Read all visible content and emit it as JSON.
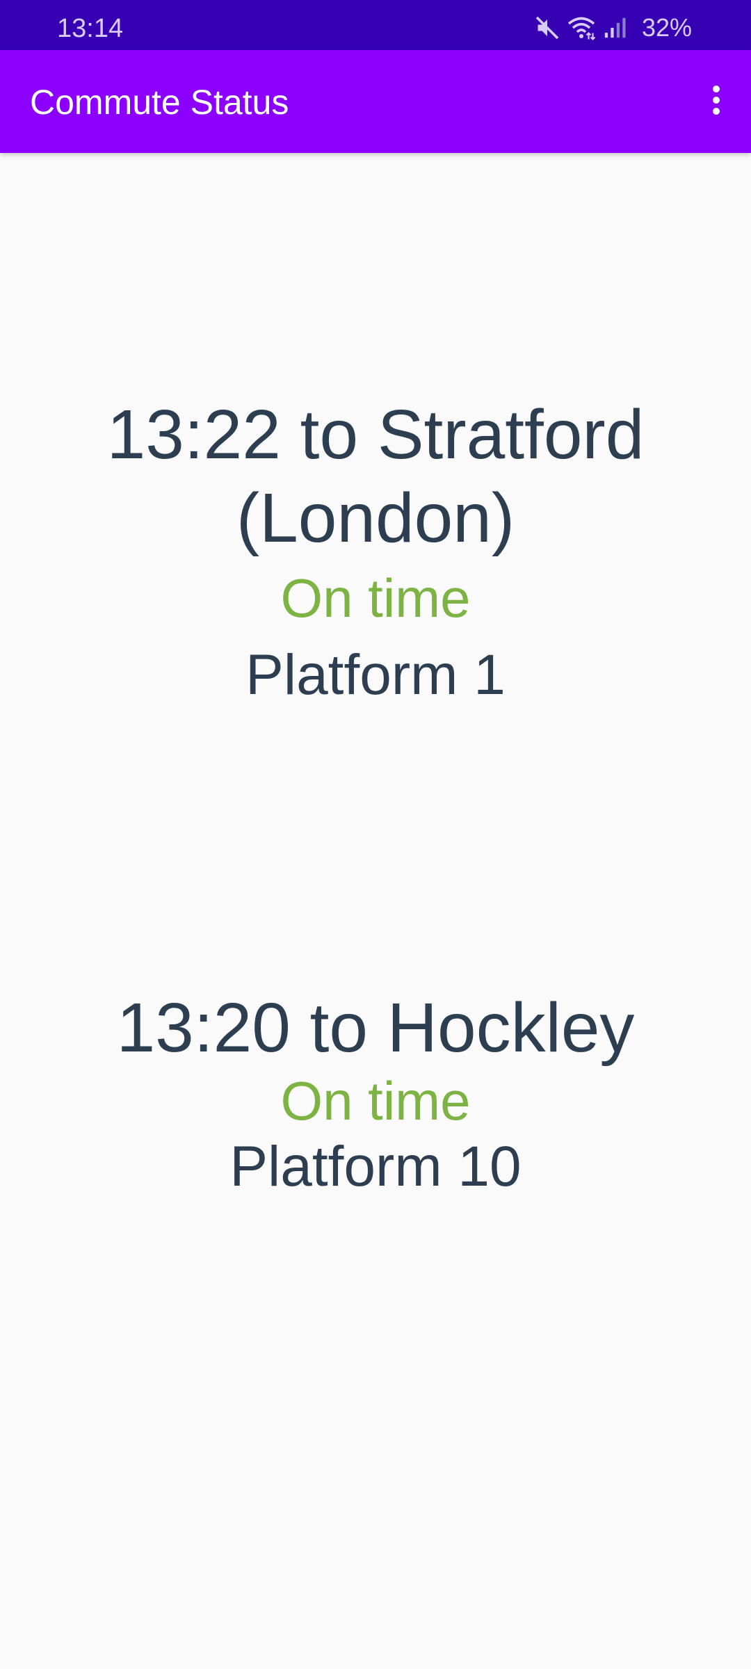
{
  "status_bar": {
    "time": "13:14",
    "battery": "32%",
    "icons": [
      "mute-icon",
      "wifi-icon",
      "signal-icon"
    ]
  },
  "app_bar": {
    "title": "Commute Status",
    "menu_icon": "more-vert-icon"
  },
  "colors": {
    "status_bar": "#3700b3",
    "app_bar": "#8c00ff",
    "text": "#2c3e50",
    "on_time": "#7cb342",
    "background": "#fafafa"
  },
  "services": [
    {
      "title": "13:22 to Stratford (London)",
      "status": "On time",
      "platform": "Platform 1"
    },
    {
      "title": "13:20 to Hockley",
      "status": "On time",
      "platform": "Platform 10"
    }
  ]
}
